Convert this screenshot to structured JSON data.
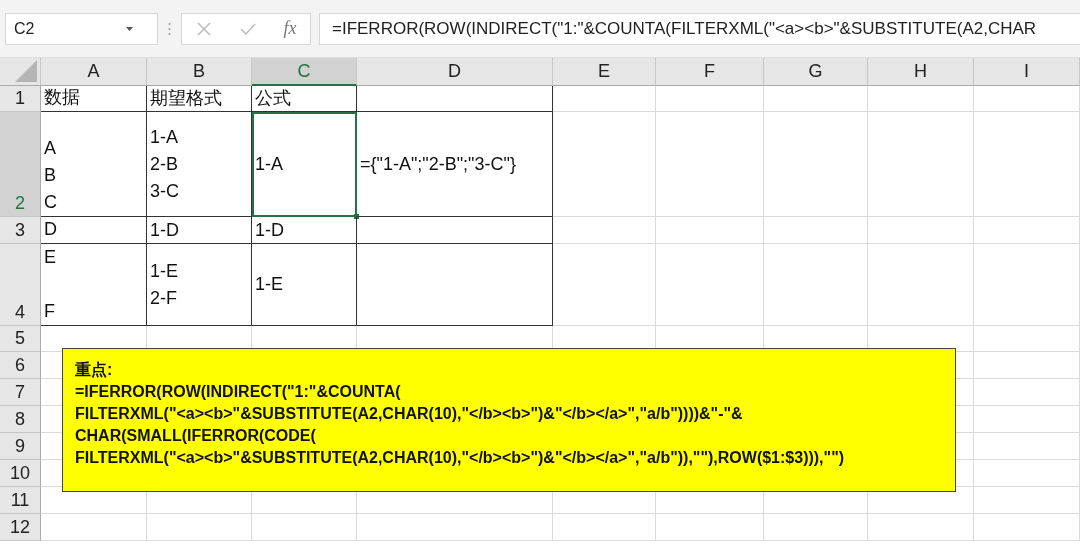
{
  "name_box": "C2",
  "function_label": "fx",
  "formula": "=IFERROR(ROW(INDIRECT(\"1:\"&COUNTA(FILTERXML(\"<a><b>\"&SUBSTITUTE(A2,CHAR",
  "columns": [
    {
      "label": "A",
      "selected": false
    },
    {
      "label": "B",
      "selected": false
    },
    {
      "label": "C",
      "selected": true
    },
    {
      "label": "D",
      "selected": false
    },
    {
      "label": "E",
      "selected": false
    },
    {
      "label": "F",
      "selected": false
    },
    {
      "label": "G",
      "selected": false
    },
    {
      "label": "H",
      "selected": false
    },
    {
      "label": "I",
      "selected": false
    }
  ],
  "rows": [
    {
      "label": "1",
      "selected": false,
      "cells": [
        {
          "text": "数据",
          "selected": false
        },
        {
          "text": "期望格式",
          "selected": false
        },
        {
          "text": "公式",
          "selected": false
        }
      ]
    },
    {
      "label": "2",
      "selected": true,
      "cells": [
        {
          "text": "A\nB\nC",
          "selected": false
        },
        {
          "text": "1-A\n2-B\n3-C",
          "selected": false
        },
        {
          "text": "1-A",
          "selected": true
        },
        {
          "text": "={\"1-A\";\"2-B\";\"3-C\"}",
          "selected": false
        }
      ]
    },
    {
      "label": "3",
      "selected": false,
      "cells": [
        {
          "text": "D",
          "selected": false
        },
        {
          "text": "1-D",
          "selected": false
        },
        {
          "text": "1-D",
          "selected": false
        }
      ]
    },
    {
      "label": "4",
      "selected": false,
      "cells": [
        {
          "text": "E\n\nF",
          "selected": false
        },
        {
          "text": "1-E\n2-F",
          "selected": false
        },
        {
          "text": "1-E",
          "selected": false
        }
      ]
    },
    {
      "label": "5",
      "selected": false,
      "cells": []
    },
    {
      "label": "6",
      "selected": false,
      "cells": []
    },
    {
      "label": "7",
      "selected": false,
      "cells": []
    },
    {
      "label": "8",
      "selected": false,
      "cells": []
    },
    {
      "label": "9",
      "selected": false,
      "cells": []
    },
    {
      "label": "10",
      "selected": false,
      "cells": []
    },
    {
      "label": "11",
      "selected": false,
      "cells": []
    },
    {
      "label": "12",
      "selected": false,
      "cells": []
    }
  ],
  "note": {
    "title": "重点:",
    "lines": [
      "=IFERROR(ROW(INDIRECT(\"1:\"&COUNTA(",
      "FILTERXML(\"<a><b>\"&SUBSTITUTE(A2,CHAR(10),\"</b><b>\")&\"</b></a>\",\"a/b\"))))&\"-\"&",
      "CHAR(SMALL(IFERROR(CODE(",
      "FILTERXML(\"<a><b>\"&SUBSTITUTE(A2,CHAR(10),\"</b><b>\")&\"</b></a>\",\"a/b\")),\"\"),ROW($1:$3))),\"\")"
    ]
  }
}
